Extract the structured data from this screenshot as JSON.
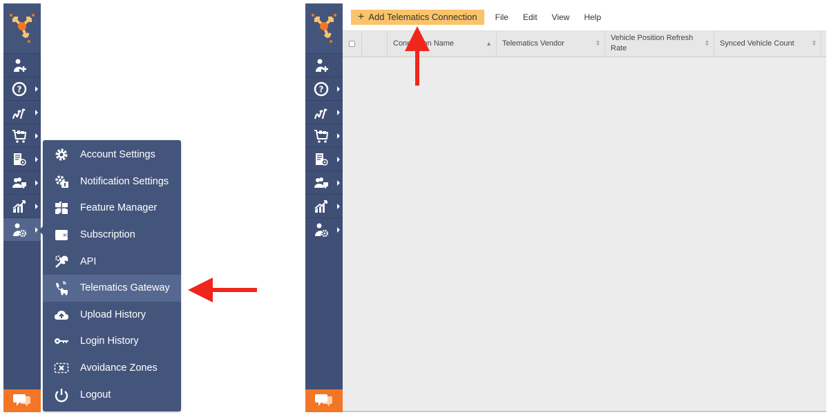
{
  "left_screen": {
    "sidebar": {
      "items": [
        {
          "icon": "add-user-icon",
          "has_submenu": false
        },
        {
          "icon": "help-icon",
          "has_submenu": true
        },
        {
          "icon": "routes-icon",
          "has_submenu": true
        },
        {
          "icon": "cart-icon",
          "has_submenu": true
        },
        {
          "icon": "address-book-icon",
          "has_submenu": true
        },
        {
          "icon": "team-vehicle-icon",
          "has_submenu": true
        },
        {
          "icon": "analytics-icon",
          "has_submenu": true
        },
        {
          "icon": "user-settings-icon",
          "has_submenu": true,
          "active": true
        }
      ]
    },
    "settings_menu": {
      "items": [
        {
          "label": "Account Settings",
          "icon": "gear-icon"
        },
        {
          "label": "Notification Settings",
          "icon": "notification-settings-icon"
        },
        {
          "label": "Feature Manager",
          "icon": "puzzle-icon"
        },
        {
          "label": "Subscription",
          "icon": "wallet-icon"
        },
        {
          "label": "API",
          "icon": "wrench-icon"
        },
        {
          "label": "Telematics Gateway",
          "icon": "telematics-icon",
          "highlighted": true
        },
        {
          "label": "Upload History",
          "icon": "cloud-upload-icon"
        },
        {
          "label": "Login History",
          "icon": "key-icon"
        },
        {
          "label": "Avoidance Zones",
          "icon": "avoidance-zone-icon"
        },
        {
          "label": "Logout",
          "icon": "power-icon"
        }
      ]
    }
  },
  "right_screen": {
    "toolbar": {
      "add_button": "Add Telematics Connection",
      "add_symbol": "+",
      "menus": [
        "File",
        "Edit",
        "View",
        "Help"
      ]
    },
    "grid": {
      "columns": [
        {
          "label": "Connection Name",
          "sort": "▲"
        },
        {
          "label": "Telematics Vendor",
          "sort": "⇕"
        },
        {
          "label": "Vehicle Position Refresh Rate",
          "sort": "⇕"
        },
        {
          "label": "Synced Vehicle Count",
          "sort": "⇕"
        }
      ],
      "rows": []
    }
  },
  "colors": {
    "sidebar": "#3f4f75",
    "menu": "#44557c",
    "accent_orange": "#f37526",
    "add_button": "#f9c46b",
    "annotation_arrow": "#f0261c"
  }
}
